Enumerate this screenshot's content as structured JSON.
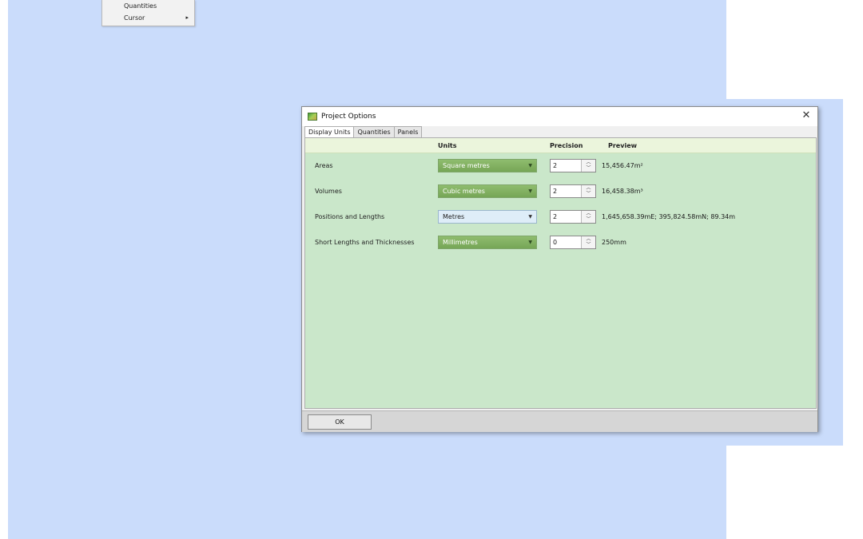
{
  "context_menu": {
    "items": [
      {
        "label": "Quantities",
        "has_submenu": false
      },
      {
        "label": "Cursor",
        "has_submenu": true,
        "arrow": "▸"
      }
    ]
  },
  "dialog": {
    "title": "Project Options",
    "title_icon": "project-icon",
    "close_glyph": "✕",
    "tabs": [
      {
        "label": "Display Units",
        "active": true
      },
      {
        "label": "Quantities",
        "active": false
      },
      {
        "label": "Panels",
        "active": false
      }
    ],
    "columns": {
      "units": "Units",
      "precision": "Precision",
      "preview": "Preview"
    },
    "rows": [
      {
        "label": "Areas",
        "unit": "Square metres",
        "precision": "2",
        "preview": "15,456.47m²",
        "combo_style": "green"
      },
      {
        "label": "Volumes",
        "unit": "Cubic metres",
        "precision": "2",
        "preview": "16,458.38m³",
        "combo_style": "green"
      },
      {
        "label": "Positions and Lengths",
        "unit": "Metres",
        "precision": "2",
        "preview": "1,645,658.39mE; 395,824.58mN; 89.34m",
        "combo_style": "plain"
      },
      {
        "label": "Short Lengths and Thicknesses",
        "unit": "Millimetres",
        "precision": "0",
        "preview": "250mm",
        "combo_style": "green"
      }
    ],
    "ok_label": "OK"
  },
  "colors": {
    "desktop": "#cadcfb",
    "panel": "#cae7ca",
    "combo_green": "#82b262"
  }
}
